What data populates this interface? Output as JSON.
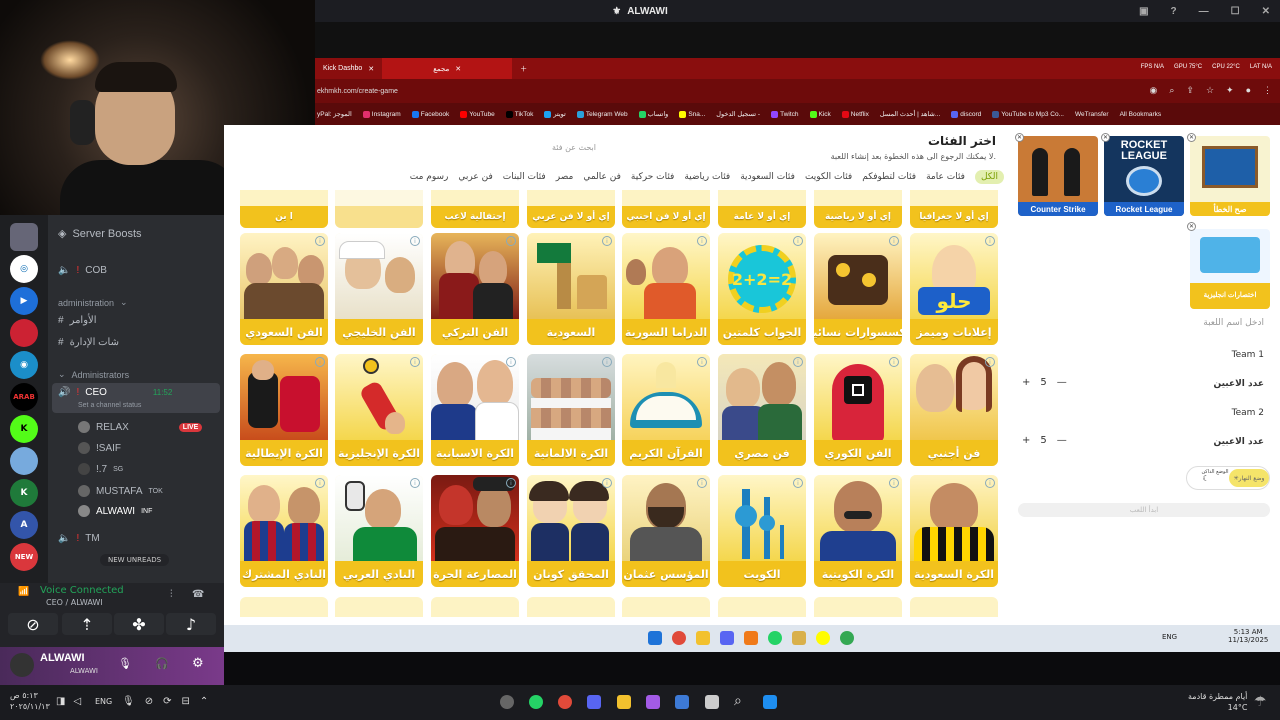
{
  "outer": {
    "title": "ALWAWI"
  },
  "browser": {
    "tabs": [
      {
        "label": "Kick Dashbo"
      },
      {
        "label": "مجمع"
      }
    ],
    "url": "ekhmkh.com/create-game",
    "stats": [
      "FPS N/A",
      "GPU 75°C",
      "CPU 22°C",
      "LAT N/A"
    ],
    "bookmarks": [
      "yPal: الموجز",
      "Instagram",
      "Facebook",
      "YouTube",
      "TikTok",
      "تويتر",
      "Telegram Web",
      "واتساب",
      "Sna...",
      "تسجيل الدخول -",
      "Twitch",
      "Kick",
      "Netflix",
      "شاهد | أحدث المسل...",
      "discord",
      "YouTube to Mp3 Co...",
      "WeTransfer",
      "All Bookmarks"
    ]
  },
  "discord": {
    "server_boosts": "Server Boosts",
    "channels": [
      {
        "label": "COB",
        "type": "voice"
      },
      {
        "label": "administration",
        "type": "category"
      },
      {
        "label": "الأوامر",
        "type": "text"
      },
      {
        "label": "شات الإدارة",
        "type": "text"
      },
      {
        "label": "Administrators",
        "type": "category"
      },
      {
        "label": "CEO",
        "type": "voice",
        "time": "11:52",
        "status": "Set a channel status"
      },
      {
        "label": "RELAX",
        "badge": "LIVE"
      },
      {
        "label": "!SAIF"
      },
      {
        "label": "!.7",
        "badge": "SG"
      },
      {
        "label": "MUSTAFA",
        "badge": "TOK"
      },
      {
        "label": "ALWAWI",
        "badge": "INF"
      },
      {
        "label": "TM",
        "type": "voice"
      }
    ],
    "new_unreads": "NEW UNREADS",
    "new_label": "NEW",
    "voice_connected": "Voice Connected",
    "voice_channel": "CEO / ALWAWI",
    "user": {
      "name": "ALWAWI",
      "tag": "ALWAWI"
    }
  },
  "page": {
    "title": "اختر الفئات",
    "subtitle": "لا يمكنك الرجوع الى هذه الخطوة بعد إنشاء اللعبة.",
    "search_placeholder": "ابحث عن فئة",
    "filters": [
      "الكل",
      "فئات عامة",
      "فئات لتطوفكم",
      "فئات الكويت",
      "فئات السعودية",
      "فئات رياضية",
      "فئات حركية",
      "فن عالمي",
      "مصر",
      "فئات البنات",
      "فن عربي",
      "رسوم مت"
    ],
    "top_row": [
      "إي أو لا جغرافيا",
      "إي أو لا رياضية",
      "إي أو لا عامة",
      "إي أو لا فن اجنبي",
      "إي أو لا فن عربي",
      "إحتفالية لاعب",
      "",
      "ا ين"
    ],
    "row1": [
      "إعلانات وميمز",
      "إكسسوارات نسائية",
      "الجواب كلمتين",
      "الدراما السورية",
      "السعودية",
      "الفن التركي",
      "الفن الخليجي",
      "الفن السعودي"
    ],
    "row2": [
      "فن أجنبي",
      "الفن الكوري",
      "فن مصري",
      "القرآن الكريم",
      "الكرة الالمانية",
      "الكرة الاسبانية",
      "الكرة الإنجليزية",
      "الكرة الإيطالية"
    ],
    "row3": [
      "الكرة السعودية",
      "الكرة الكويتية",
      "الكويت",
      "المؤسس عثمان",
      "المحقق كونان",
      "المصارعة الحرة",
      "النادي العربي",
      "النادي المشترك"
    ],
    "art2plus2": "2+2=2",
    "helw": "حلو",
    "selected": [
      {
        "label": "صح الخطأ"
      },
      {
        "label": "Rocket League",
        "logo": "ROCKET LEAGUE"
      },
      {
        "label": "Counter Strike"
      },
      {
        "label": "اختصارات انجليزية"
      }
    ],
    "game_name_placeholder": "ادخل اسم اللعبة",
    "team1": "Team 1",
    "team2": "Team 2",
    "players_label": "عدد الاعبين",
    "team1_players": 5,
    "team2_players": 5,
    "mode_dark": "الوضع الداكن",
    "mode_day": "وضع النهار",
    "start_button": "ابدأ اللعب"
  },
  "inner_taskbar": {
    "time": "5:13 AM",
    "date": "11/13/2025",
    "lang": "ENG"
  },
  "outer_taskbar": {
    "time": "٥:١٣ ص",
    "date": "٢٠٢٥/١١/١٣",
    "lang": "ENG",
    "weather": "أيام ممطرة قادمة",
    "temp": "14°C"
  }
}
